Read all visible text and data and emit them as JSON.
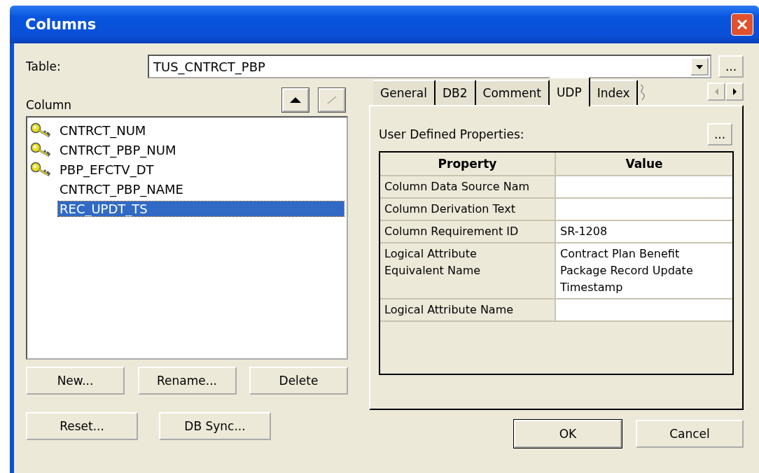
{
  "window": {
    "title": "Columns"
  },
  "table_field": {
    "label": "Table:",
    "value": "TUS_CNTRCT_PBP",
    "browse_button": "..."
  },
  "column_list": {
    "label": "Column",
    "items": [
      {
        "name": "CNTRCT_NUM",
        "key": true,
        "selected": false
      },
      {
        "name": "CNTRCT_PBP_NUM",
        "key": true,
        "selected": false
      },
      {
        "name": "PBP_EFCTV_DT",
        "key": true,
        "selected": false
      },
      {
        "name": "CNTRCT_PBP_NAME",
        "key": false,
        "selected": false
      },
      {
        "name": "REC_UPDT_TS",
        "key": false,
        "selected": true
      }
    ],
    "move_up": {
      "disabled": false
    },
    "move_down": {
      "disabled": true
    }
  },
  "list_buttons": [
    "New...",
    "Rename...",
    "Delete"
  ],
  "bottom_left_buttons": [
    "Reset...",
    "DB Sync..."
  ],
  "tabs": [
    {
      "label": "General",
      "selected": false
    },
    {
      "label": "DB2",
      "selected": false
    },
    {
      "label": "Comment",
      "selected": false
    },
    {
      "label": "UDP",
      "selected": true
    },
    {
      "label": "Index",
      "selected": false
    }
  ],
  "tab_scroll": {
    "left_disabled": true,
    "right_disabled": false
  },
  "udp": {
    "label": "User Defined Properties:",
    "edit_button": "...",
    "columns": [
      "Property",
      "Value"
    ],
    "rows": [
      {
        "property": "Column Data Source Nam",
        "value": ""
      },
      {
        "property": "Column Derivation Text",
        "value": ""
      },
      {
        "property": "Column Requirement ID",
        "value": "SR-1208"
      },
      {
        "property": "Logical Attribute Equivalent Name",
        "value": "Contract Plan Benefit Package Record Update Timestamp"
      },
      {
        "property": "Logical Attribute Name",
        "value": ""
      }
    ]
  },
  "dialog_buttons": [
    {
      "label": "OK",
      "default": true
    },
    {
      "label": "Cancel",
      "default": false
    }
  ]
}
